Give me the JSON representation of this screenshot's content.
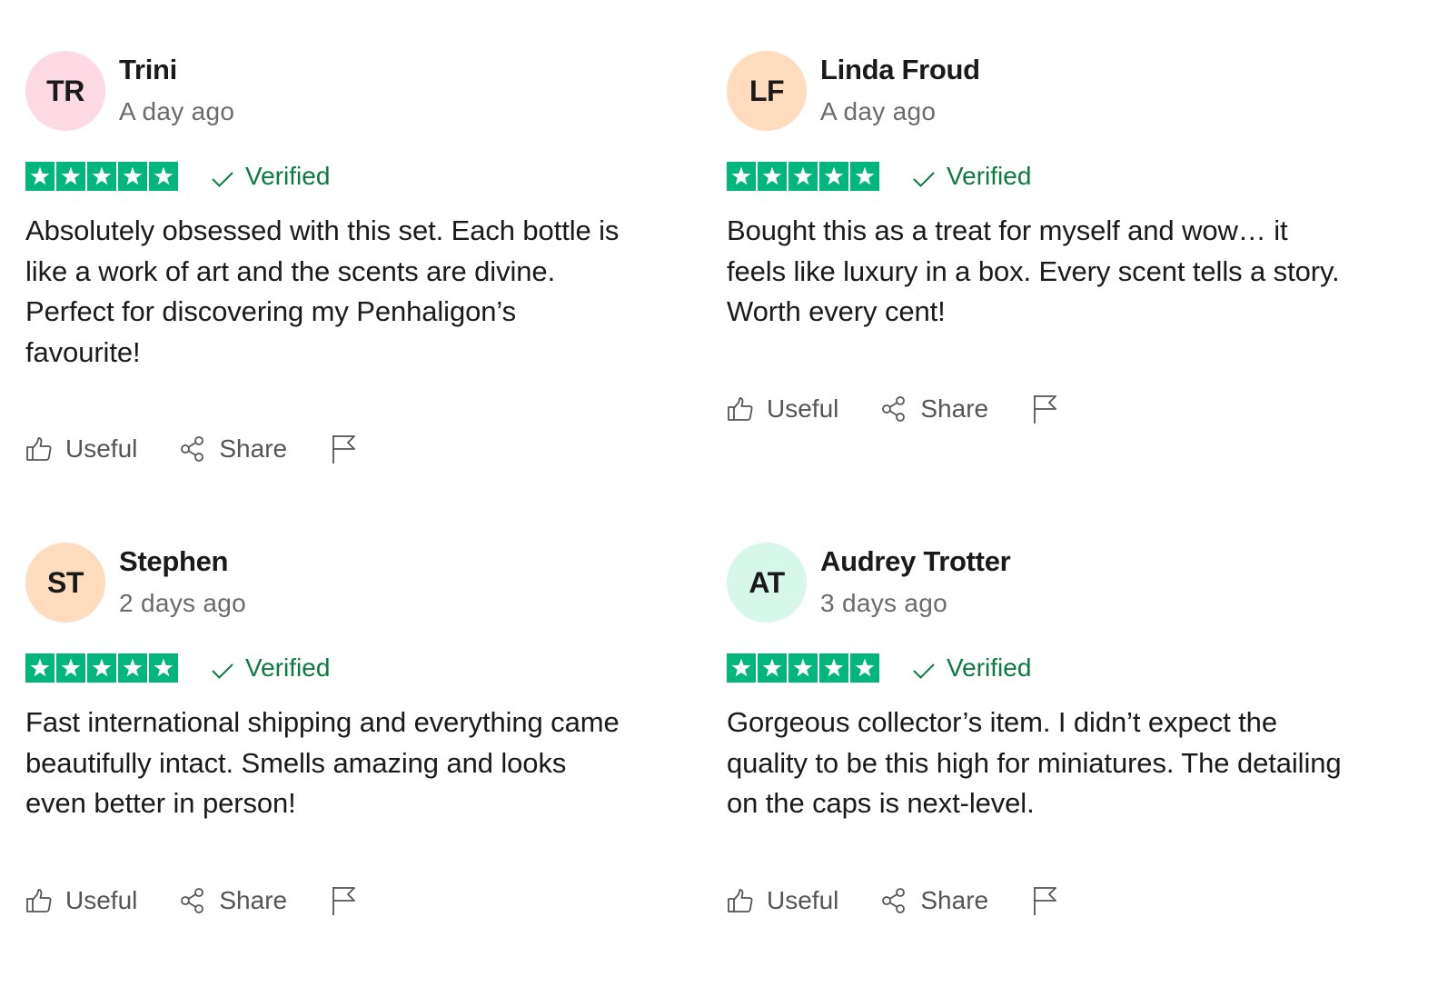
{
  "colors": {
    "star_green": "#00b67a",
    "verified_green": "#0b7a41",
    "muted_text": "#6b6b6b",
    "action_text": "#555555"
  },
  "icons": {
    "star": "star-icon",
    "verified": "checkmark-icon",
    "useful": "thumbs-up-icon",
    "share": "share-icon",
    "report": "flag-icon"
  },
  "reviews": [
    {
      "initials": "TR",
      "avatar_color": "#fdd9e3",
      "name": "Trini",
      "date": "A day ago",
      "rating": 5,
      "verified_label": "Verified",
      "text": "Absolutely obsessed with this set. Each bottle is like a work of art and the scents are divine. Perfect for discovering my Penhaligon’s favourite!",
      "useful_label": "Useful",
      "share_label": "Share"
    },
    {
      "initials": "LF",
      "avatar_color": "#fedcbd",
      "name": "Linda Froud",
      "date": "A day ago",
      "rating": 5,
      "verified_label": "Verified",
      "text": "Bought this as a treat for myself and wow… it feels like luxury in a box. Every scent tells a story. Worth every cent!",
      "useful_label": "Useful",
      "share_label": "Share"
    },
    {
      "initials": "ST",
      "avatar_color": "#fedcbd",
      "name": "Stephen",
      "date": "2 days ago",
      "rating": 5,
      "verified_label": "Verified",
      "text": "Fast international shipping and everything came beautifully intact. Smells amazing and looks even better in person!",
      "useful_label": "Useful",
      "share_label": "Share"
    },
    {
      "initials": "AT",
      "avatar_color": "#d6f7ea",
      "name": "Audrey Trotter",
      "date": "3 days ago",
      "rating": 5,
      "verified_label": "Verified",
      "text": "Gorgeous collector’s item. I didn’t expect the quality to be this high for miniatures. The detailing on the caps is next-level.",
      "useful_label": "Useful",
      "share_label": "Share"
    }
  ]
}
